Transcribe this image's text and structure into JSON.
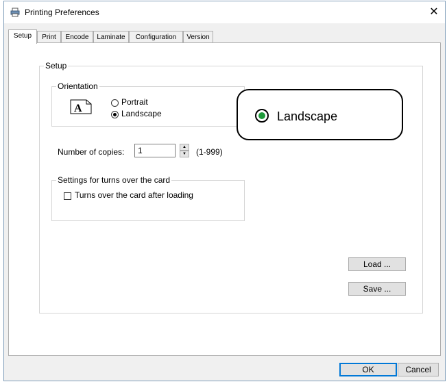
{
  "window": {
    "title": "Printing Preferences",
    "close_glyph": "✕"
  },
  "tabs": [
    {
      "label": "Setup",
      "active": true
    },
    {
      "label": "Print",
      "active": false
    },
    {
      "label": "Encode",
      "active": false
    },
    {
      "label": "Laminate",
      "active": false
    },
    {
      "label": "Configuration",
      "active": false
    },
    {
      "label": "Version",
      "active": false
    }
  ],
  "setup": {
    "group_label": "Setup",
    "orientation": {
      "group_label": "Orientation",
      "icon_glyph": "A",
      "portrait_label": "Portrait",
      "landscape_label": "Landscape",
      "selected": "Landscape"
    },
    "copies": {
      "label": "Number of copies:",
      "value": "1",
      "range_hint": "(1-999)",
      "up_glyph": "▲",
      "down_glyph": "▼"
    },
    "turns": {
      "group_label": "Settings for turns over the card",
      "checkbox_label": "Turns over the card after loading",
      "checked": false
    },
    "load_label": "Load ...",
    "save_label": "Save ..."
  },
  "footer": {
    "ok_label": "OK",
    "cancel_label": "Cancel"
  },
  "callout": {
    "text": "Landscape",
    "accent_color": "#1e9a3a"
  }
}
